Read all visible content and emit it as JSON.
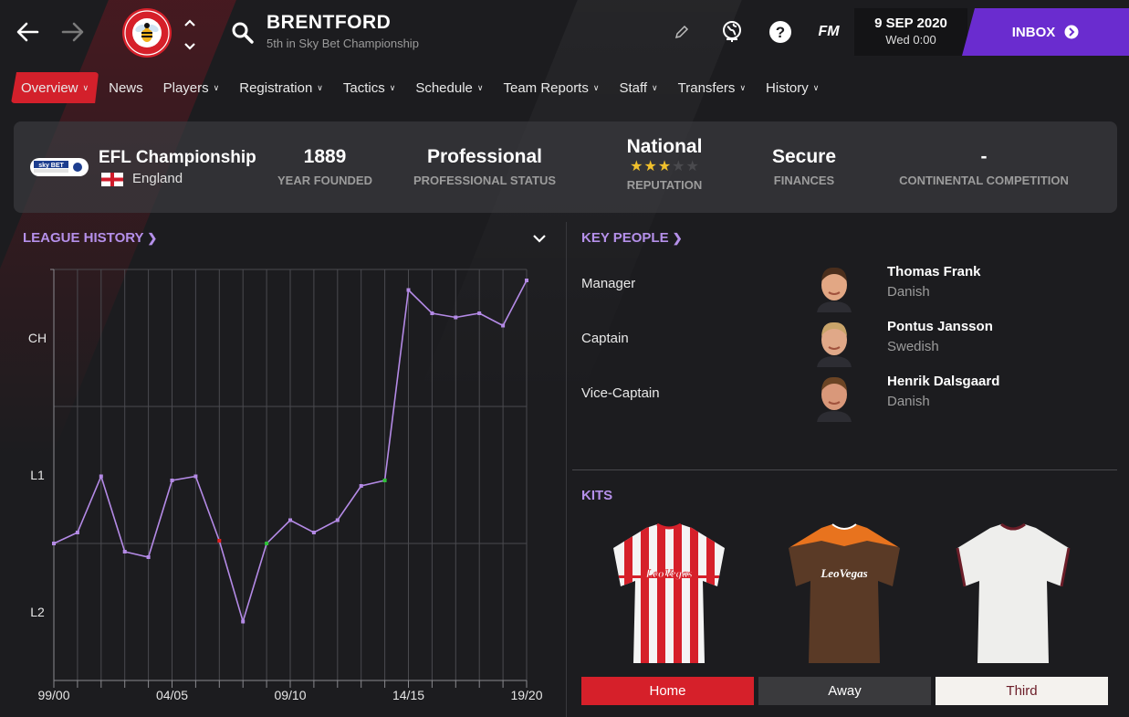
{
  "header": {
    "club_name": "BRENTFORD",
    "club_subtitle": "5th in Sky Bet Championship",
    "date": "9 SEP 2020",
    "time": "Wed 0:00",
    "inbox_label": "INBOX",
    "fm_label": "FM",
    "icons": [
      "back-arrow-icon",
      "forward-arrow-icon",
      "club-crest-icon",
      "chevron-up-icon",
      "chevron-down-icon",
      "search-icon",
      "edit-pencil-icon",
      "world-icon",
      "help-icon",
      "fm-logo-icon",
      "arrow-circle-right-icon"
    ]
  },
  "tabs": [
    {
      "label": "Overview",
      "active": true,
      "dropdown": true
    },
    {
      "label": "News",
      "active": false,
      "dropdown": false
    },
    {
      "label": "Players",
      "active": false,
      "dropdown": true
    },
    {
      "label": "Registration",
      "active": false,
      "dropdown": true
    },
    {
      "label": "Tactics",
      "active": false,
      "dropdown": true
    },
    {
      "label": "Schedule",
      "active": false,
      "dropdown": true
    },
    {
      "label": "Team Reports",
      "active": false,
      "dropdown": true
    },
    {
      "label": "Staff",
      "active": false,
      "dropdown": true
    },
    {
      "label": "Transfers",
      "active": false,
      "dropdown": true
    },
    {
      "label": "History",
      "active": false,
      "dropdown": true
    }
  ],
  "info": {
    "competition": "EFL Championship",
    "country": "England",
    "competition_logo_text": "sky BET",
    "year_founded": "1889",
    "year_founded_label": "YEAR FOUNDED",
    "status": "Professional",
    "status_label": "PROFESSIONAL STATUS",
    "reputation": "National",
    "reputation_label": "REPUTATION",
    "reputation_stars": 3,
    "reputation_max": 5,
    "finances": "Secure",
    "finances_label": "FINANCES",
    "continental": "-",
    "continental_label": "CONTINENTAL COMPETITION"
  },
  "league_history": {
    "title": "LEAGUE HISTORY",
    "title_icon": "chevron-right-icon",
    "dropdown_icon": "chevron-down-icon"
  },
  "chart_data": {
    "type": "line",
    "title": "LEAGUE HISTORY",
    "x": [
      "99/00",
      "00/01",
      "01/02",
      "02/03",
      "03/04",
      "04/05",
      "05/06",
      "06/07",
      "07/08",
      "08/09",
      "09/10",
      "10/11",
      "11/12",
      "12/13",
      "13/14",
      "14/15",
      "15/16",
      "16/17",
      "17/18",
      "18/19",
      "19/20"
    ],
    "xtick_labels": [
      "99/00",
      "04/05",
      "09/10",
      "14/15",
      "19/20"
    ],
    "ytick_labels": [
      "CH",
      "L1",
      "L2"
    ],
    "y_units": "league level (1 = Championship, 2 = League One, 3 = League Two); fractional part = position within division",
    "ylim": [
      0.5,
      3.5
    ],
    "y_inverted": true,
    "values": [
      2.5,
      2.42,
      2.01,
      2.56,
      2.6,
      2.04,
      2.01,
      2.48,
      3.07,
      2.5,
      2.33,
      2.42,
      2.33,
      2.08,
      2.04,
      0.65,
      0.82,
      0.85,
      0.82,
      0.91,
      0.58
    ],
    "markers": [
      {
        "season": "06/07",
        "color": "#e02020",
        "meaning": "relegated"
      },
      {
        "season": "08/09",
        "color": "#2fc23a",
        "meaning": "promoted"
      },
      {
        "season": "13/14",
        "color": "#2fc23a",
        "meaning": "promoted"
      }
    ],
    "line_color": "#b48ae6",
    "grid": true
  },
  "key_people": {
    "title": "KEY PEOPLE",
    "title_icon": "chevron-right-icon",
    "people": [
      {
        "role": "Manager",
        "name": "Thomas Frank",
        "nationality": "Danish"
      },
      {
        "role": "Captain",
        "name": "Pontus Jansson",
        "nationality": "Swedish"
      },
      {
        "role": "Vice-Captain",
        "name": "Henrik Dalsgaard",
        "nationality": "Danish"
      }
    ]
  },
  "kits": {
    "title": "KITS",
    "sponsor": "LeoVegas",
    "items": [
      {
        "label": "Home",
        "active": true
      },
      {
        "label": "Away",
        "active": false
      },
      {
        "label": "Third",
        "active": false
      }
    ],
    "colors": {
      "home_red": "#d6202a",
      "away_brown": "#5a3a26",
      "away_orange": "#e8731e",
      "third_white": "#eeeeec",
      "third_trim": "#6b1d28"
    }
  },
  "colors": {
    "accent_red": "#d3202b",
    "inbox_purple": "#6a2ccf",
    "section_purple": "#b590ea",
    "star_gold": "#f0c02c"
  }
}
